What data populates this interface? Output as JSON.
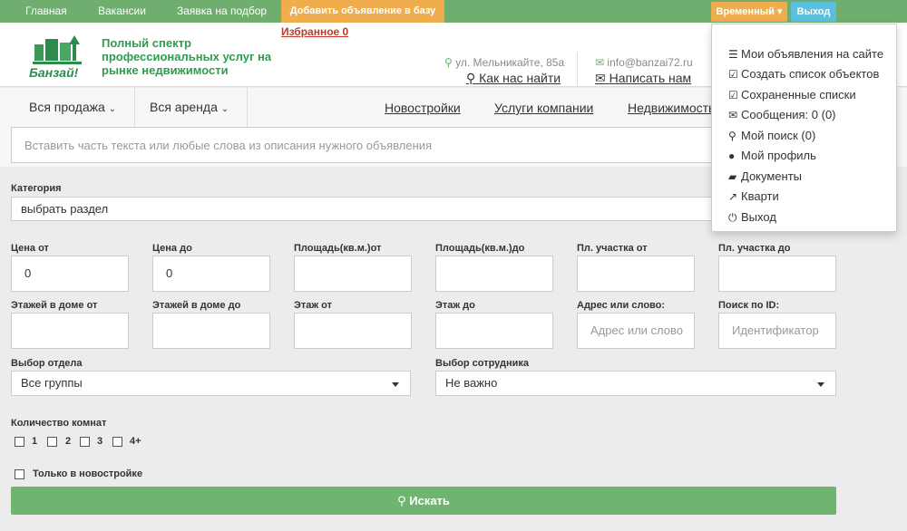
{
  "topnav": {
    "home": "Главная",
    "vacancies": "Вакансии",
    "request": "Заявка на подбор",
    "add_ad": "Добавить объявление в базу",
    "temp": "Временный",
    "exit": "Выход",
    "favorites": "Избранное 0"
  },
  "header": {
    "logo_text": "Банзай!",
    "slogan": "Полный спектр профессиональных услуг на рынке недвижимости",
    "address": "ул. Мельникайте, 85а",
    "how_to_find": "Как нас найти",
    "email": "info@banzai72.ru",
    "write_us": "Написать нам"
  },
  "nav2": {
    "sale": "Вся продажа",
    "rent": "Вся аренда",
    "new_builds": "Новостройки",
    "services": "Услуги компании",
    "realty": "Недвижимость"
  },
  "search": {
    "placeholder": "Вставить часть текста или любые слова из описания нужного объявления"
  },
  "form": {
    "category_label": "Категория",
    "category_value": "выбрать раздел",
    "price_from": "Цена от",
    "price_from_value": "0",
    "price_to": "Цена до",
    "price_to_value": "0",
    "area_from": "Площадь(кв.м.)от",
    "area_to": "Площадь(кв.м.)до",
    "plot_from": "Пл. участка от",
    "plot_to": "Пл. участка до",
    "floors_from": "Этажей в доме от",
    "floors_to": "Этажей в доме до",
    "floor_from": "Этаж от",
    "floor_to": "Этаж до",
    "address_label": "Адрес или слово:",
    "address_placeholder": "Адрес или слово",
    "id_label": "Поиск по ID:",
    "id_placeholder": "Идентификатор",
    "dept_label": "Выбор отдела",
    "dept_value": "Все группы",
    "employee_label": "Выбор сотрудника",
    "employee_value": "Не важно",
    "rooms_label": "Количество комнат",
    "rooms": [
      "1",
      "2",
      "3",
      "4+"
    ],
    "new_only": "Только в новостройке",
    "search_btn": "Искать"
  },
  "menu": {
    "items": [
      {
        "icon": "list-icon",
        "label": "Мои объявления на сайте"
      },
      {
        "icon": "check-square-icon",
        "label": "Создать список объектов"
      },
      {
        "icon": "check-square-icon",
        "label": "Сохраненные списки"
      },
      {
        "icon": "envelope-icon",
        "label": "Сообщения: 0 (0)"
      },
      {
        "icon": "search-icon",
        "label": "Мой поиск (0)"
      },
      {
        "icon": "user-icon",
        "label": "Мой профиль"
      },
      {
        "icon": "folder-icon",
        "label": "Документы"
      },
      {
        "icon": "share-icon",
        "label": "Кварти"
      },
      {
        "icon": "power-icon",
        "label": "Выход"
      }
    ]
  }
}
